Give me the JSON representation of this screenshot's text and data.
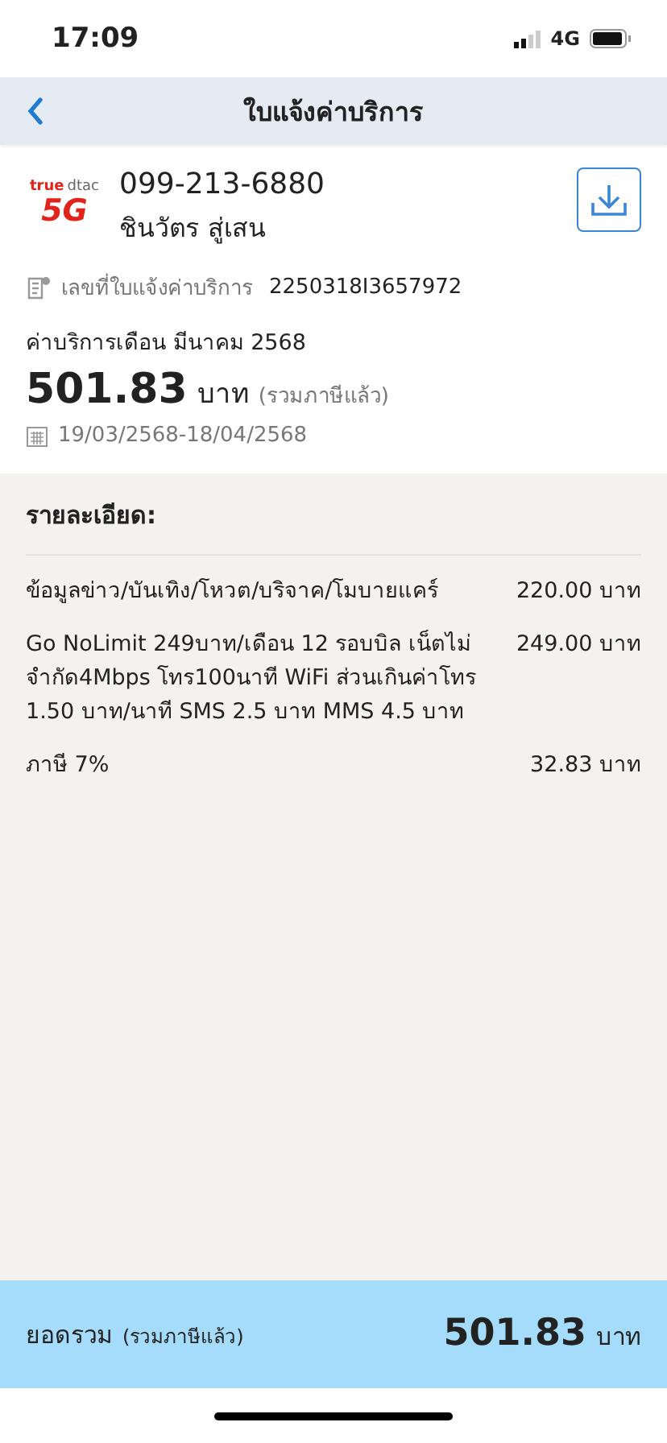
{
  "status_bar": {
    "time": "17:09",
    "network": "4G"
  },
  "nav": {
    "title": "ใบแจ้งค่าบริการ"
  },
  "account": {
    "logo": {
      "brand_left": "true",
      "brand_right": "dtac",
      "badge": "5G"
    },
    "phone": "099-213-6880",
    "name": "ชินวัตร สู่เสน",
    "invoice_label": "เลขที่ใบแจ้งค่าบริการ",
    "invoice_number": "2250318I3657972",
    "period_label": "ค่าบริการเดือน มีนาคม 2568",
    "amount": "501.83",
    "currency": "บาท",
    "tax_note": "(รวมภาษีแล้ว)",
    "date_range": "19/03/2568-18/04/2568"
  },
  "details": {
    "title": "รายละเอียด:",
    "items": [
      {
        "description": "ข้อมูลข่าว/บันเทิง/โหวต/บริจาค/โมบายแคร์",
        "amount": "220.00 บาท"
      },
      {
        "description": "Go NoLimit 249บาท/เดือน 12 รอบบิล เน็ตไม่จำกัด4Mbps โทร100นาที WiFi ส่วนเกินค่าโทร 1.50 บาท/นาที SMS 2.5 บาท MMS 4.5 บาท",
        "amount": "249.00 บาท"
      },
      {
        "description": "ภาษี 7%",
        "amount": "32.83 บาท"
      }
    ]
  },
  "total": {
    "label": "ยอดรวม",
    "tax_note": "(รวมภาษีแล้ว)",
    "amount": "501.83",
    "currency": "บาท"
  }
}
